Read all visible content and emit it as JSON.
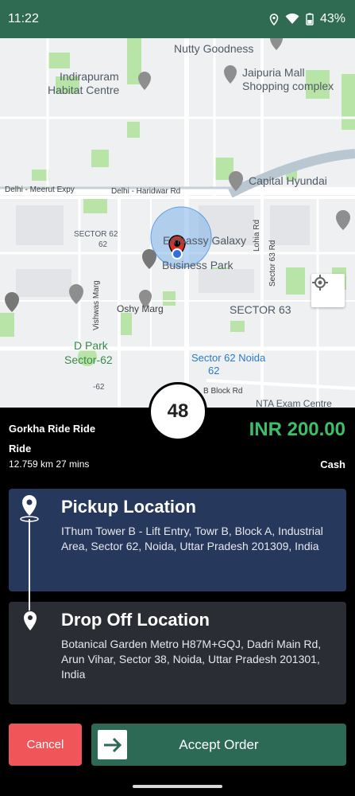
{
  "status": {
    "time": "11:22",
    "battery": "43%"
  },
  "map": {
    "labels": {
      "nutty": "Nutty Goodness",
      "jaipuria_1": "Jaipuria Mall",
      "jaipuria_2": "Shopping complex",
      "indirapuram_1": "Indirapuram",
      "indirapuram_2": "Habitat Centre",
      "meerut": "Delhi - Meerut Expy",
      "haridwar": "Delhi - Haridwar Rd",
      "capital": "Capital Hyundai",
      "sector62_a": "SECTOR 62",
      "sector62_b": "62",
      "embassy_1": "Embassy Galaxy",
      "embassy_2": "Business Park",
      "lohia": "Lohia Rd",
      "sector63rd": "Sector 63 Rd",
      "vishwas": "Vishwas Marg",
      "oshy": "Oshy Marg",
      "sector63": "SECTOR 63",
      "dpark_1": "D Park",
      "dpark_2": "Sector-62",
      "s62noida_1": "Sector 62 Noida",
      "s62noida_2": "62",
      "minus62": "-62",
      "bblock": "B Block Rd",
      "nta": "NTA Exam Centre"
    }
  },
  "counter": "48",
  "ride": {
    "title": "Gorkha Ride Ride",
    "type": "Ride",
    "meta": "12.759 km 27 mins",
    "fare": "INR 200.00",
    "payment": "Cash"
  },
  "pickup": {
    "title": "Pickup Location",
    "address": "IThum Tower B - Lift Entry, Towr B, Block A, Industrial Area, Sector 62, Noida, Uttar Pradesh 201309, India"
  },
  "drop": {
    "title": "Drop Off Location",
    "address": "Botanical Garden Metro H87M+GQJ, Dadri Main Rd, Arun Vihar, Sector 38, Noida, Uttar Pradesh 201301, India"
  },
  "actions": {
    "cancel": "Cancel",
    "accept": "Accept Order"
  },
  "colors": {
    "header": "#2f6b53",
    "fare": "#3dbf6a",
    "pickup_card": "#26395c",
    "drop_card": "#2a2d34",
    "cancel": "#f0555a",
    "accept": "#2d6a55"
  }
}
